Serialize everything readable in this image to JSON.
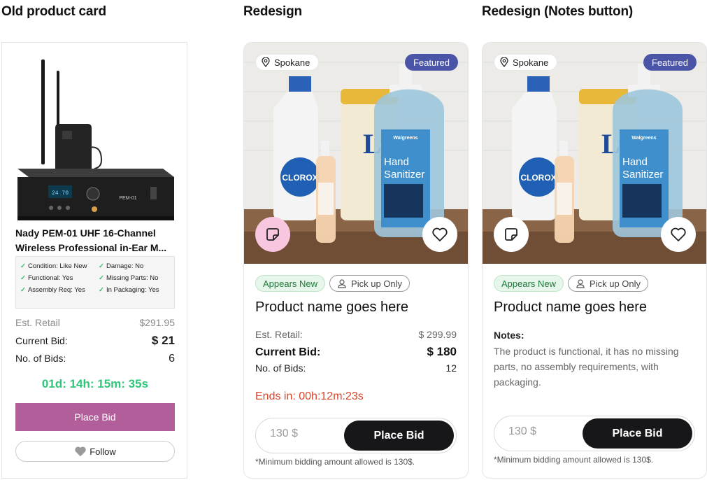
{
  "headings": {
    "old": "Old product card",
    "redesign": "Redesign",
    "redesign_notes": "Redesign (Notes button)"
  },
  "old_card": {
    "title_line1": "Nady PEM-01 UHF 16-Channel",
    "title_line2": "Wireless Professional in-Ear M...",
    "conditions": [
      "Condition: Like New",
      "Damage: No",
      "Functional: Yes",
      "Missing Parts: No",
      "Assembly Req: Yes",
      "In Packaging: Yes"
    ],
    "est_retail_label": "Est. Retail",
    "est_retail_value": "$291.95",
    "current_bid_label": "Current Bid:",
    "current_bid_value": "$ 21",
    "num_bids_label": "No. of Bids:",
    "num_bids_value": "6",
    "timer": "01d: 14h: 15m: 35s",
    "place_bid": "Place Bid",
    "follow": "Follow",
    "device_label": "PEM-01",
    "device_display": "24 70"
  },
  "card_a": {
    "location": "Spokane",
    "featured": "Featured",
    "tag_new": "Appears New",
    "tag_pick": "Pick up Only",
    "name": "Product name goes here",
    "est_retail_label": "Est. Retail:",
    "est_retail_value": "$ 299.99",
    "current_bid_label": "Current Bid:",
    "current_bid_value": "$ 180",
    "num_bids_label": "No. of Bids:",
    "num_bids_value": "12",
    "ends": "Ends in: 00h:12m:23s",
    "bid_placeholder": "130 $",
    "place_bid": "Place Bid",
    "min_note": "*Minimum bidding amount allowed is 130$."
  },
  "card_b": {
    "location": "Spokane",
    "featured": "Featured",
    "tag_new": "Appears New",
    "tag_pick": "Pick up Only",
    "name": "Product name goes here",
    "notes_label": "Notes:",
    "notes_text": "The product is functional, it has no missing parts, no assembly requirements, with packaging.",
    "bid_placeholder": "130 $",
    "place_bid": "Place Bid",
    "min_note": "*Minimum bidding amount allowed is 130$."
  },
  "product_photo_text": {
    "bleach_brand": "CLOROX",
    "wipes_brand": "Lysol",
    "sanitizer_store": "Walgreens",
    "sanitizer_title1": "Hand",
    "sanitizer_title2": "Sanitizer"
  },
  "colors": {
    "featured": "#4a55a8",
    "old_bid_button": "#b15e9b",
    "timer_green": "#2fc67a",
    "ends_red": "#d9452a",
    "notes_btn_active": "#f9c6e0"
  }
}
